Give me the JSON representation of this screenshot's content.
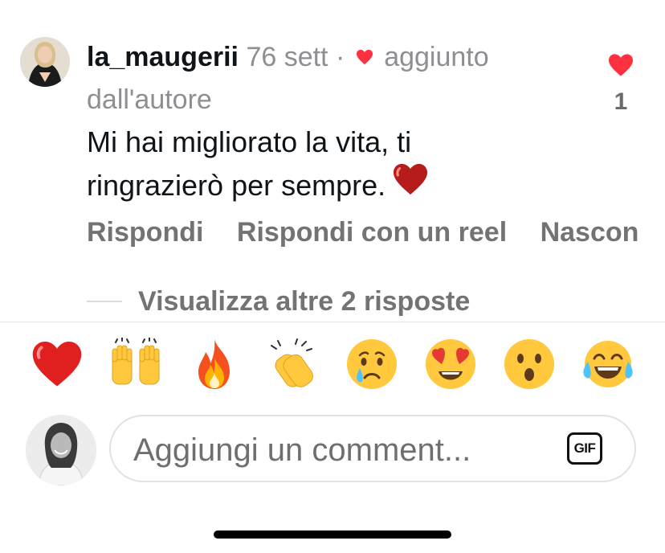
{
  "comment": {
    "username": "la_maugerii",
    "time": "76 sett",
    "separator": "·",
    "liked_by_author_label": "aggiunto dall'autore",
    "text": "Mi hai migliorato la vita, ti ringrazierò per sempre.",
    "like_count": "1",
    "like_icon": "heart-icon",
    "heart_color": "#ff3040"
  },
  "actions": {
    "reply": "Rispondi",
    "reply_reel": "Rispondi con un reel",
    "hide": "Nascon"
  },
  "replies": {
    "view_more": "Visualizza altre 2 risposte"
  },
  "emoji_bar": [
    {
      "name": "red-heart",
      "glyph": "❤️"
    },
    {
      "name": "raising-hands",
      "glyph": "🙌"
    },
    {
      "name": "fire",
      "glyph": "🔥"
    },
    {
      "name": "clapping-hands",
      "glyph": "👏"
    },
    {
      "name": "crying-face",
      "glyph": "😢"
    },
    {
      "name": "heart-eyes",
      "glyph": "😍"
    },
    {
      "name": "astonished-face",
      "glyph": "😮"
    },
    {
      "name": "tears-of-joy",
      "glyph": "😂"
    }
  ],
  "composer": {
    "placeholder": "Aggiungi un comment...",
    "gif_label": "GIF"
  }
}
